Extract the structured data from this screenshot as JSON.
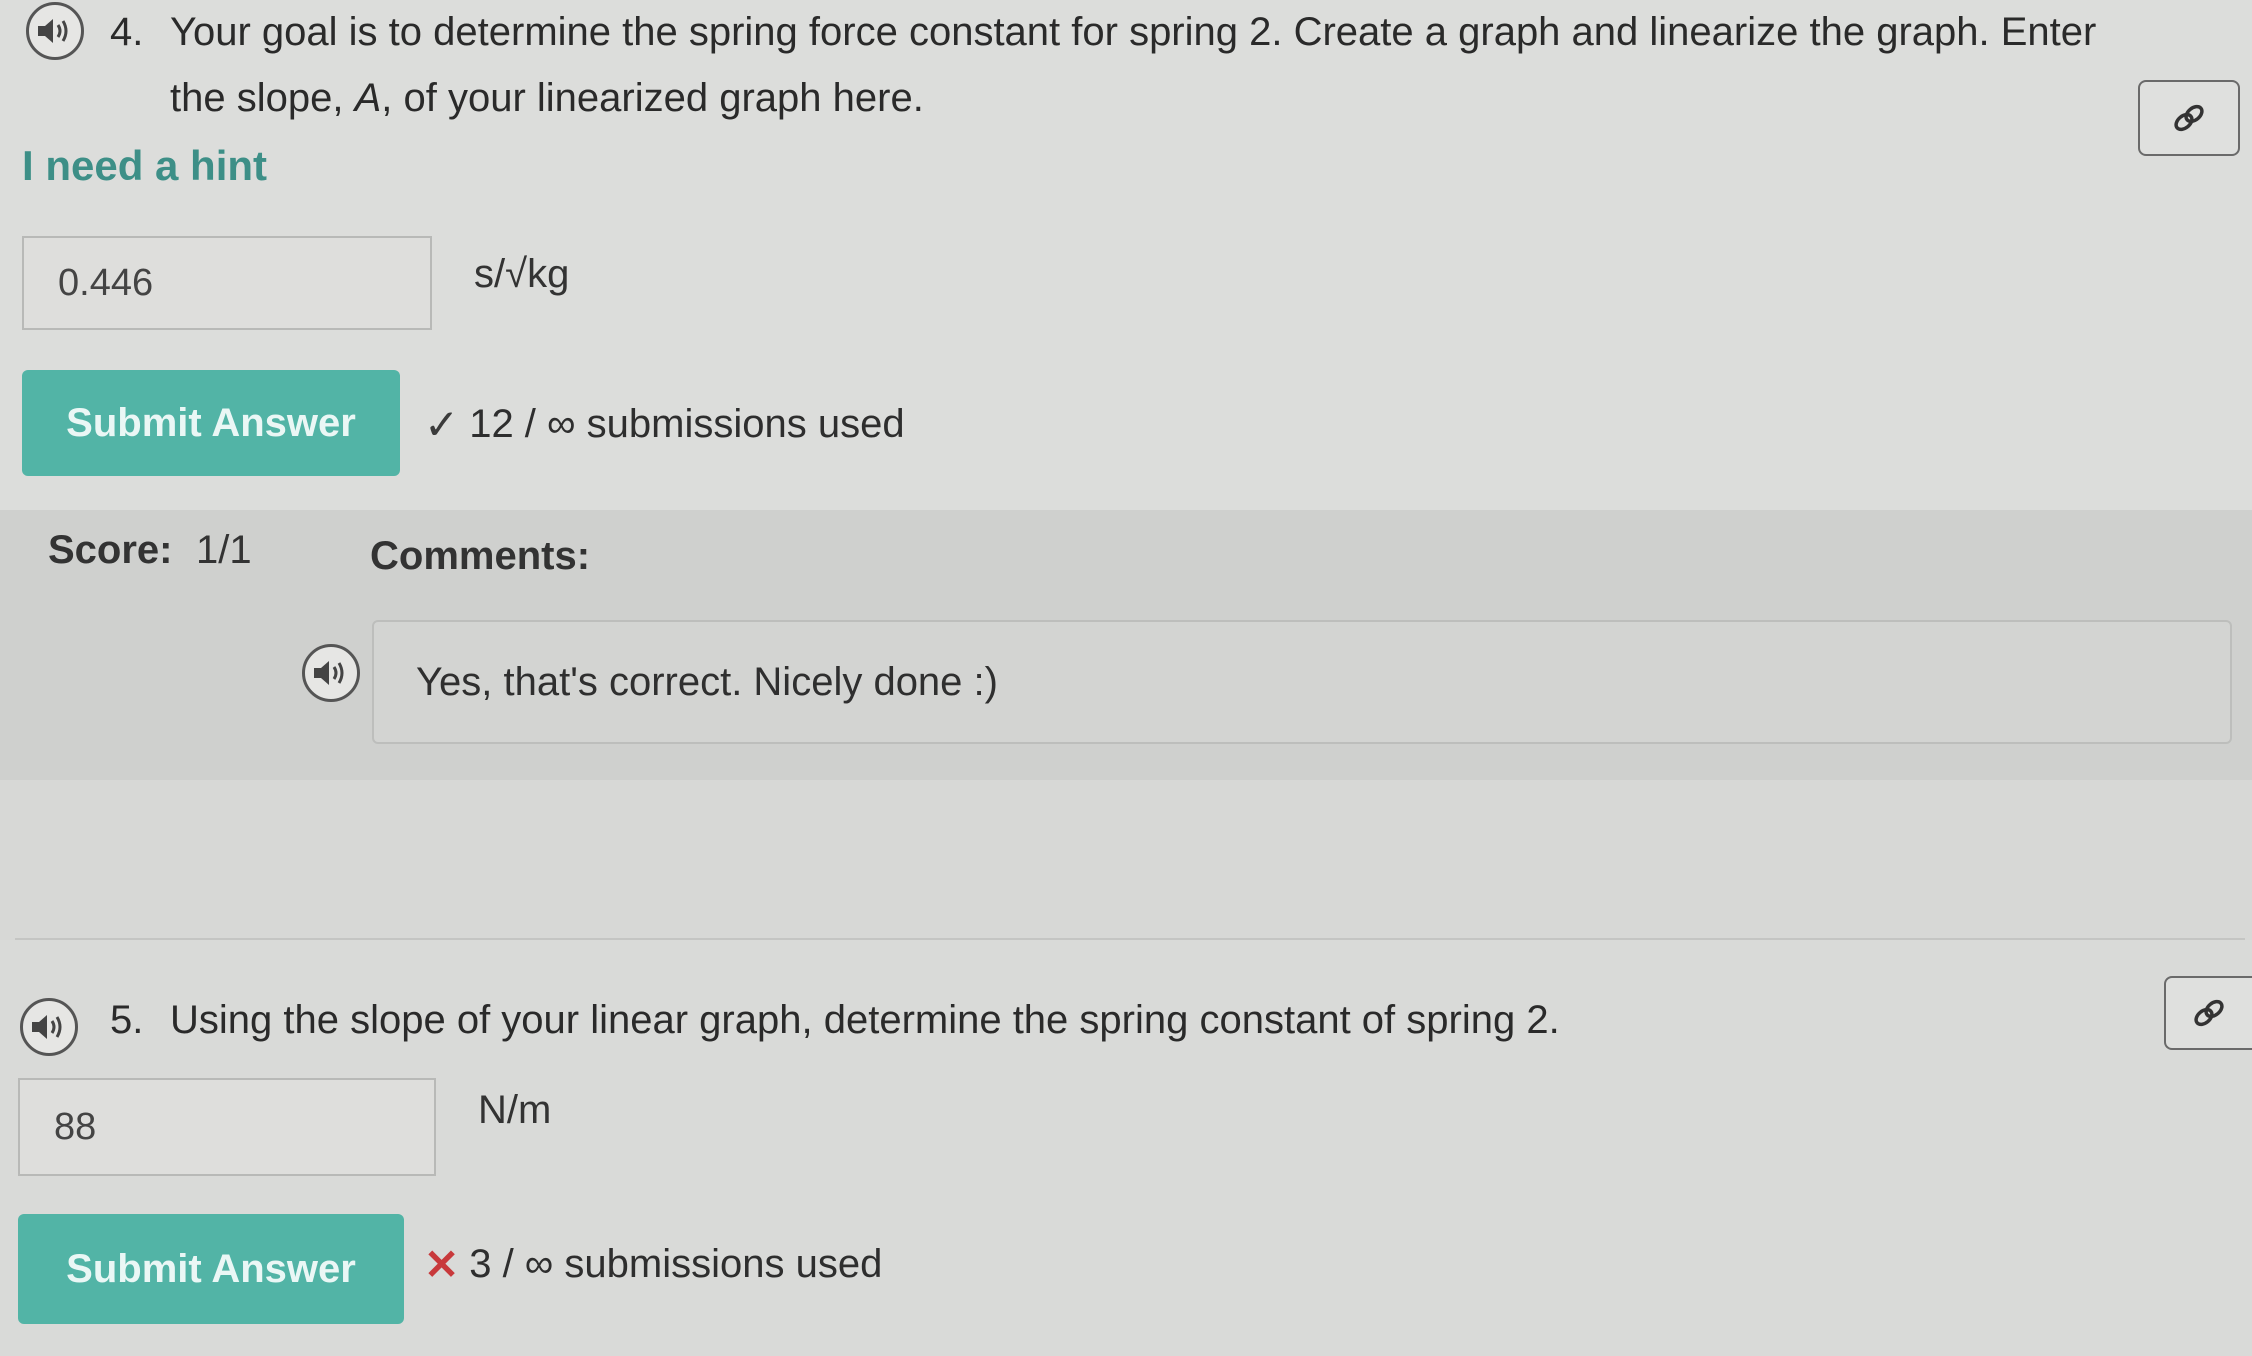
{
  "q4": {
    "number": "4.",
    "line1": "Your goal is to determine the spring force constant for spring 2. Create a graph and linearize the graph. Enter",
    "line2_prefix": "the slope, ",
    "line2_var": "A",
    "line2_suffix": ", of your linearized graph here.",
    "hint": "I need a hint",
    "answer_value": "0.446",
    "unit": "s/√kg",
    "submit_label": "Submit Answer",
    "status_icon": "check-icon",
    "submissions": "12 / ∞ submissions used",
    "score_label": "Score:",
    "score_value": "1/1",
    "comments_label": "Comments:",
    "comment": "Yes, that's correct. Nicely done :)"
  },
  "q5": {
    "number": "5.",
    "text": "Using the slope of your linear graph, determine the spring constant of spring 2.",
    "answer_value": "88",
    "unit": "N/m",
    "submit_label": "Submit Answer",
    "status_icon": "cross-icon",
    "submissions": "3 / ∞ submissions used"
  },
  "colors": {
    "accent": "#52b4a6",
    "hint": "#3d8f87",
    "error": "#c8393b"
  }
}
